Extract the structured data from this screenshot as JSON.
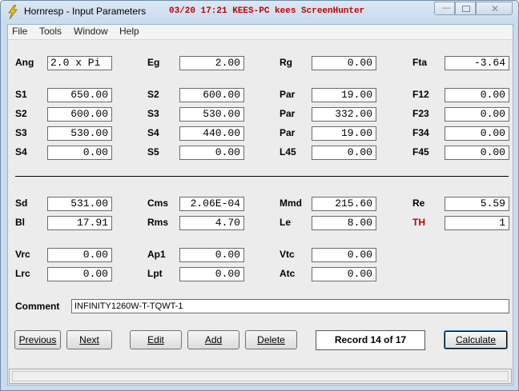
{
  "window": {
    "title": "Hornresp - Input Parameters",
    "overlay_text": "03/20 17:21 KEES-PC kees ScreenHunter"
  },
  "menu": [
    "File",
    "Tools",
    "Window",
    "Help"
  ],
  "rows": [
    [
      [
        "Ang",
        "2.0 x Pi"
      ],
      [
        "Eg",
        "2.00"
      ],
      [
        "Rg",
        "0.00"
      ],
      [
        "Fta",
        "-3.64"
      ]
    ],
    [
      [
        "S1",
        "650.00"
      ],
      [
        "S2",
        "600.00"
      ],
      [
        "Par",
        "19.00"
      ],
      [
        "F12",
        "0.00"
      ]
    ],
    [
      [
        "S2",
        "600.00"
      ],
      [
        "S3",
        "530.00"
      ],
      [
        "Par",
        "332.00"
      ],
      [
        "F23",
        "0.00"
      ]
    ],
    [
      [
        "S3",
        "530.00"
      ],
      [
        "S4",
        "440.00"
      ],
      [
        "Par",
        "19.00"
      ],
      [
        "F34",
        "0.00"
      ]
    ],
    [
      [
        "S4",
        "0.00"
      ],
      [
        "S5",
        "0.00"
      ],
      [
        "L45",
        "0.00"
      ],
      [
        "F45",
        "0.00"
      ]
    ],
    [
      [
        "Sd",
        "531.00"
      ],
      [
        "Cms",
        "2.06E-04"
      ],
      [
        "Mmd",
        "215.60"
      ],
      [
        "Re",
        "5.59"
      ]
    ],
    [
      [
        "Bl",
        "17.91"
      ],
      [
        "Rms",
        "4.70"
      ],
      [
        "Le",
        "8.00"
      ],
      [
        "TH",
        "1"
      ]
    ],
    [
      [
        "Vrc",
        "0.00"
      ],
      [
        "Ap1",
        "0.00"
      ],
      [
        "Vtc",
        "0.00"
      ]
    ],
    [
      [
        "Lrc",
        "0.00"
      ],
      [
        "Lpt",
        "0.00"
      ],
      [
        "Atc",
        "0.00"
      ]
    ]
  ],
  "comment": {
    "label": "Comment",
    "value": "INFINITY1260W-T-TQWT-1"
  },
  "buttons": {
    "previous": "Previous",
    "next": "Next",
    "edit": "Edit",
    "add": "Add",
    "delete": "Delete",
    "calculate": "Calculate"
  },
  "record": "Record 14 of 17",
  "colors": {
    "highlight_label": "#c00000",
    "overlay_text": "#c00000"
  }
}
